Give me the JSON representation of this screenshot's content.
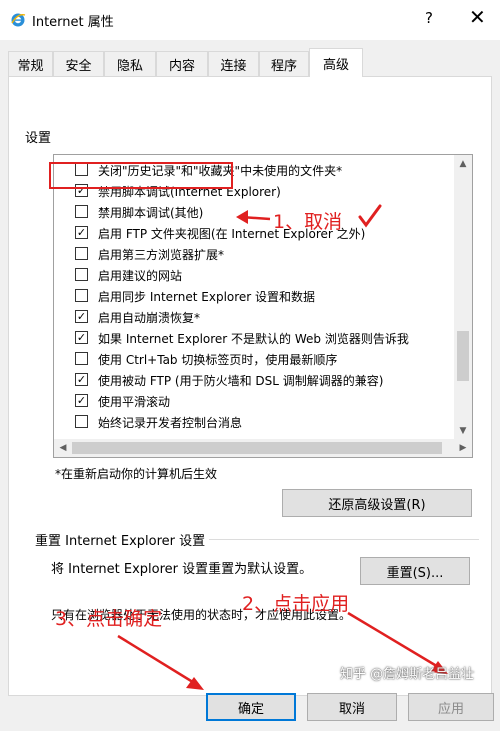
{
  "window": {
    "title": "Internet 属性",
    "help": "?",
    "close": "✕"
  },
  "tabs": [
    {
      "label": "常规",
      "active": false
    },
    {
      "label": "安全",
      "active": false
    },
    {
      "label": "隐私",
      "active": false
    },
    {
      "label": "内容",
      "active": false
    },
    {
      "label": "连接",
      "active": false
    },
    {
      "label": "程序",
      "active": false
    },
    {
      "label": "高级",
      "active": true
    }
  ],
  "settings": {
    "group_label": "设置",
    "items": [
      {
        "label": "关闭\"历史记录\"和\"收藏夹\"中未使用的文件夹*",
        "checked": false
      },
      {
        "label": "禁用脚本调试(Internet Explorer)",
        "checked": true
      },
      {
        "label": "禁用脚本调试(其他)",
        "checked": false
      },
      {
        "label": "启用 FTP 文件夹视图(在 Internet Explorer 之外)",
        "checked": true
      },
      {
        "label": "启用第三方浏览器扩展*",
        "checked": false
      },
      {
        "label": "启用建议的网站",
        "checked": false
      },
      {
        "label": "启用同步 Internet Explorer 设置和数据",
        "checked": false
      },
      {
        "label": "启用自动崩溃恢复*",
        "checked": true
      },
      {
        "label": "如果 Internet Explorer 不是默认的 Web 浏览器则告诉我",
        "checked": true
      },
      {
        "label": "使用 Ctrl+Tab 切换标签页时，使用最新顺序",
        "checked": false
      },
      {
        "label": "使用被动 FTP (用于防火墙和 DSL 调制解调器的兼容)",
        "checked": true
      },
      {
        "label": "使用平滑滚动",
        "checked": true
      },
      {
        "label": "始终记录开发者控制台消息",
        "checked": false
      }
    ],
    "restart_note": "*在重新启动你的计算机后生效",
    "restore_button": "还原高级设置(R)"
  },
  "reset": {
    "group_title": "重置 Internet Explorer 设置",
    "description": "将 Internet Explorer 设置重置为默认设置。",
    "button": "重置(S)...",
    "note": "只有在浏览器处于无法使用的状态时，才应使用此设置。"
  },
  "footer": {
    "ok": "确定",
    "cancel": "取消",
    "apply": "应用"
  },
  "annotations": {
    "step1": "1、取消",
    "step2": "2、点击应用",
    "step3": "3、点击确定",
    "color": "#e02020"
  },
  "watermark": "知乎 @詹姆斯老吕益壮"
}
